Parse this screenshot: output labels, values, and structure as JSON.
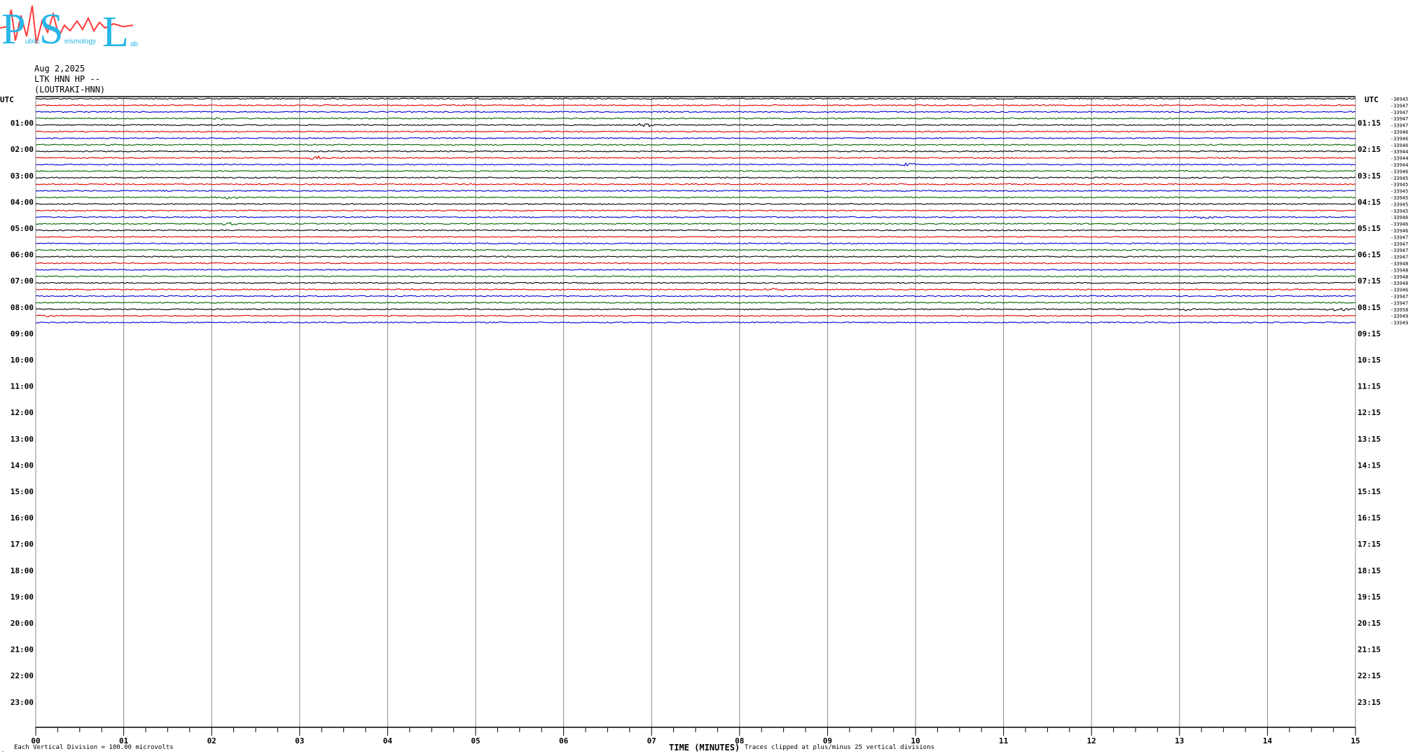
{
  "logo": {
    "letters": [
      "P",
      "S",
      "L"
    ],
    "small_words": [
      "ublic",
      "eismology",
      "ab"
    ],
    "colors": {
      "letters": "#29b6e6",
      "trace": "#ff3b3b"
    }
  },
  "header": {
    "date": "Aug 2,2025",
    "channel": "LTK HNN HP --",
    "site": "(LOUTRAKI-HNN)"
  },
  "footer": {
    "division": "Each Vertical Division =  100.00 microvolts",
    "xlabel": "TIME (MINUTES)",
    "clip": "Traces clipped at plus/minus 25 vertical divisions",
    "corner": "."
  },
  "chart_data": {
    "type": "line",
    "title": "",
    "xlabel": "TIME (MINUTES)",
    "ylabel": "",
    "xlim": [
      0,
      15
    ],
    "x_ticks": [
      "00",
      "01",
      "02",
      "03",
      "04",
      "05",
      "06",
      "07",
      "08",
      "09",
      "10",
      "11",
      "12",
      "13",
      "14",
      "15"
    ],
    "grid": true,
    "left_axis_header": "UTC",
    "right_axis_header": "UTC",
    "left_hour_labels": [
      "01:00",
      "02:00",
      "03:00",
      "04:00",
      "05:00",
      "06:00",
      "07:00",
      "08:00",
      "09:00",
      "10:00",
      "11:00",
      "12:00",
      "13:00",
      "14:00",
      "15:00",
      "16:00",
      "17:00",
      "18:00",
      "19:00",
      "20:00",
      "21:00",
      "22:00",
      "23:00"
    ],
    "right_hour_labels": [
      "01:15",
      "02:15",
      "03:15",
      "04:15",
      "05:15",
      "06:15",
      "07:15",
      "08:15",
      "09:15",
      "10:15",
      "11:15",
      "12:15",
      "13:15",
      "14:15",
      "15:15",
      "16:15",
      "17:15",
      "18:15",
      "19:15",
      "20:15",
      "21:15",
      "22:15",
      "23:15"
    ],
    "rows_per_hour": 4,
    "total_rows": 96,
    "series_colors": [
      "#000000",
      "#e00000",
      "#0000d0",
      "#006400"
    ],
    "trace_offsets": [
      "-30945",
      "-33947",
      "-33947",
      "-33947",
      "-33947",
      "-33946",
      "-33946",
      "-33946",
      "-33944",
      "-33944",
      "-33944",
      "-33946",
      "-33945",
      "-33945",
      "-33945",
      "-33945",
      "-33945",
      "-33945",
      "-33946",
      "-33946",
      "-33946",
      "-33947",
      "-33947",
      "-33947",
      "-33947",
      "-33948",
      "-33948",
      "-33948",
      "-33948",
      "-33946",
      "-33947",
      "-33947",
      "-33958",
      "-33949",
      "-33949"
    ],
    "events": [
      {
        "row": 3,
        "minute": 2.1,
        "amplitude": 2
      },
      {
        "row": 4,
        "minute": 6.9,
        "amplitude": 3
      },
      {
        "row": 9,
        "minute": 3.15,
        "amplitude": 3
      },
      {
        "row": 10,
        "minute": 9.9,
        "amplitude": 3
      },
      {
        "row": 15,
        "minute": 2.2,
        "amplitude": 2
      },
      {
        "row": 18,
        "minute": 13.3,
        "amplitude": 2
      },
      {
        "row": 19,
        "minute": 2.2,
        "amplitude": 2
      },
      {
        "row": 29,
        "minute": 8.4,
        "amplitude": 2
      },
      {
        "row": 32,
        "minute": 13.1,
        "amplitude": 2
      },
      {
        "row": 32,
        "minute": 14.8,
        "amplitude": 3
      },
      {
        "row": 33,
        "minute": 0.1,
        "amplitude": 2
      }
    ]
  }
}
